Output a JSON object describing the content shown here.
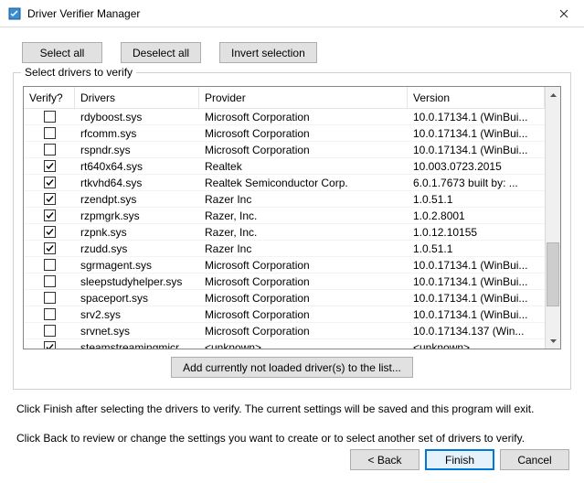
{
  "window": {
    "title": "Driver Verifier Manager"
  },
  "buttons": {
    "select_all": "Select all",
    "deselect_all": "Deselect all",
    "invert_selection": "Invert selection",
    "add_not_loaded": "Add currently not loaded driver(s) to the list...",
    "back": "< Back",
    "finish": "Finish",
    "cancel": "Cancel"
  },
  "group": {
    "label": "Select drivers to verify"
  },
  "columns": {
    "verify": "Verify?",
    "drivers": "Drivers",
    "provider": "Provider",
    "version": "Version"
  },
  "rows": [
    {
      "checked": false,
      "driver": "rdyboost.sys",
      "provider": "Microsoft Corporation",
      "version": "10.0.17134.1 (WinBui..."
    },
    {
      "checked": false,
      "driver": "rfcomm.sys",
      "provider": "Microsoft Corporation",
      "version": "10.0.17134.1 (WinBui..."
    },
    {
      "checked": false,
      "driver": "rspndr.sys",
      "provider": "Microsoft Corporation",
      "version": "10.0.17134.1 (WinBui..."
    },
    {
      "checked": true,
      "driver": "rt640x64.sys",
      "provider": "Realtek",
      "version": "10.003.0723.2015"
    },
    {
      "checked": true,
      "driver": "rtkvhd64.sys",
      "provider": "Realtek Semiconductor Corp.",
      "version": "6.0.1.7673 built by: ..."
    },
    {
      "checked": true,
      "driver": "rzendpt.sys",
      "provider": "Razer Inc",
      "version": "1.0.51.1"
    },
    {
      "checked": true,
      "driver": "rzpmgrk.sys",
      "provider": "Razer, Inc.",
      "version": "1.0.2.8001"
    },
    {
      "checked": true,
      "driver": "rzpnk.sys",
      "provider": "Razer, Inc.",
      "version": "1.0.12.10155"
    },
    {
      "checked": true,
      "driver": "rzudd.sys",
      "provider": "Razer Inc",
      "version": "1.0.51.1"
    },
    {
      "checked": false,
      "driver": "sgrmagent.sys",
      "provider": "Microsoft Corporation",
      "version": "10.0.17134.1 (WinBui..."
    },
    {
      "checked": false,
      "driver": "sleepstudyhelper.sys",
      "provider": "Microsoft Corporation",
      "version": "10.0.17134.1 (WinBui..."
    },
    {
      "checked": false,
      "driver": "spaceport.sys",
      "provider": "Microsoft Corporation",
      "version": "10.0.17134.1 (WinBui..."
    },
    {
      "checked": false,
      "driver": "srv2.sys",
      "provider": "Microsoft Corporation",
      "version": "10.0.17134.1 (WinBui..."
    },
    {
      "checked": false,
      "driver": "srvnet.sys",
      "provider": "Microsoft Corporation",
      "version": "10.0.17134.137 (Win..."
    },
    {
      "checked": true,
      "driver": "steamstreamingmicr...",
      "provider": "<unknown>",
      "version": "<unknown>"
    }
  ],
  "instructions": {
    "line1": "Click Finish after selecting the drivers to verify. The current settings will be saved and this program will exit.",
    "line2": "Click Back to review or change the settings you want to create or to select another set of drivers to verify."
  }
}
